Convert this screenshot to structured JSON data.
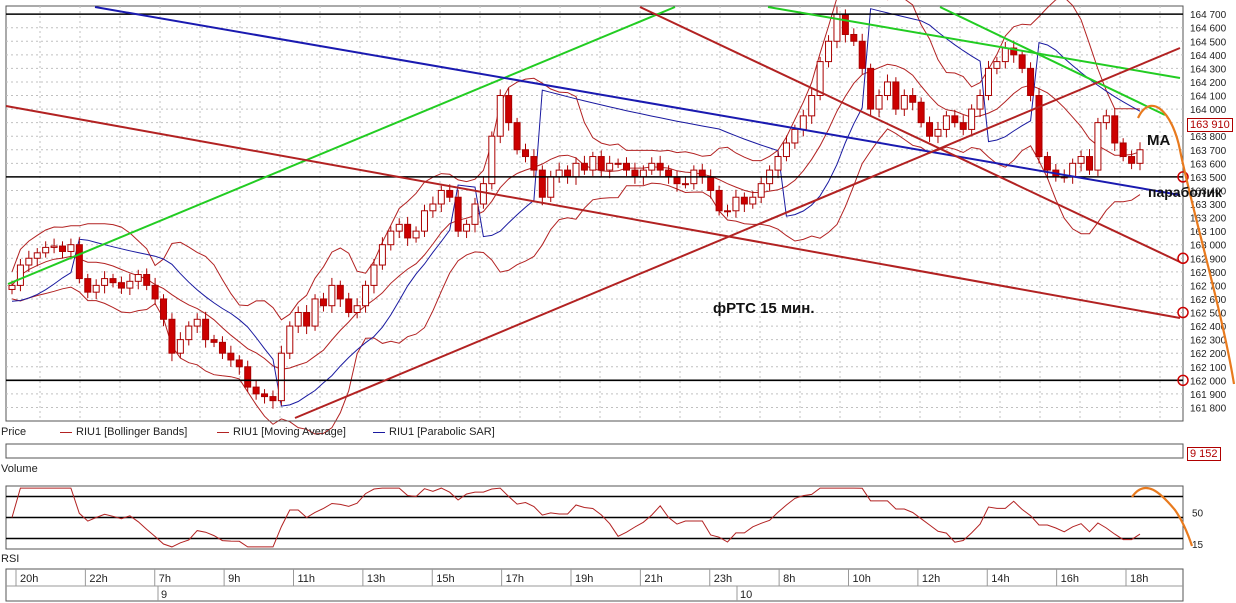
{
  "chart_data": {
    "type": "candlestick",
    "title": "фРТС   15 мин.",
    "price_axis": {
      "range": [
        161700,
        164760
      ],
      "ticks": [
        161800,
        161900,
        162000,
        162100,
        162200,
        162300,
        162400,
        162500,
        162600,
        162700,
        162800,
        162900,
        163000,
        163100,
        163200,
        163300,
        163400,
        163500,
        163600,
        163700,
        163800,
        163900,
        164000,
        164100,
        164200,
        164300,
        164400,
        164500,
        164600,
        164700
      ],
      "tick_labels": [
        "161 800",
        "161 900",
        "162 000",
        "162 100",
        "162 200",
        "162 300",
        "162 400",
        "162 500",
        "162 600",
        "162 700",
        "162 800",
        "162 900",
        "163 000",
        "163 100",
        "163 200",
        "163 300",
        "163 400",
        "163 500",
        "163 600",
        "163 700",
        "163 800",
        "163 900",
        "164 000",
        "164 100",
        "164 200",
        "164 300",
        "164 400",
        "164 500",
        "164 600",
        "164 700"
      ],
      "last_value": "163 910"
    },
    "time_axis": {
      "labels": [
        "20h",
        "22h",
        "7h",
        "9h",
        "11h",
        "13h",
        "15h",
        "17h",
        "19h",
        "21h",
        "23h",
        "8h",
        "10h",
        "12h",
        "14h",
        "16h",
        "18h"
      ],
      "dates": [
        "9",
        "10"
      ]
    },
    "legend": [
      "Price",
      "RIU1 [Bollinger Bands]",
      "RIU1 [Moving Average]",
      "RIU1 [Parabolic SAR]"
    ],
    "closes": [
      162700,
      162850,
      162900,
      162940,
      162980,
      162990,
      162950,
      163000,
      162750,
      162650,
      162700,
      162750,
      162720,
      162680,
      162730,
      162780,
      162700,
      162600,
      162450,
      162200,
      162300,
      162400,
      162450,
      162300,
      162280,
      162200,
      162150,
      162100,
      161950,
      161900,
      161880,
      161850,
      162200,
      162400,
      162500,
      162400,
      162600,
      162550,
      162700,
      162600,
      162500,
      162550,
      162700,
      162850,
      163000,
      163100,
      163150,
      163050,
      163100,
      163250,
      163300,
      163400,
      163350,
      163100,
      163150,
      163300,
      163450,
      163800,
      164100,
      163900,
      163700,
      163650,
      163550,
      163350,
      163500,
      163550,
      163500,
      163600,
      163550,
      163650,
      163550,
      163600,
      163600,
      163550,
      163500,
      163550,
      163600,
      163550,
      163500,
      163450,
      163450,
      163550,
      163500,
      163400,
      163250,
      163250,
      163350,
      163300,
      163350,
      163450,
      163550,
      163650,
      163750,
      163850,
      163950,
      164100,
      164350,
      164500,
      164700,
      164550,
      164500,
      164300,
      164000,
      164100,
      164200,
      164000,
      164100,
      164050,
      163900,
      163800,
      163850,
      163950,
      163900,
      163850,
      164000,
      164100,
      164300,
      164350,
      164450,
      164400,
      164300,
      164100,
      163650,
      163550,
      163500,
      163500,
      163600,
      163650,
      163550,
      163900,
      163950,
      163750,
      163650,
      163600,
      163700
    ],
    "horizontal_levels": [
      164700,
      163500,
      162000
    ],
    "circled_levels": [
      163500,
      162900,
      162500,
      162000
    ],
    "annotations": [
      "MA",
      "параболик"
    ],
    "volume": {
      "label": "Volume",
      "last_value": "9 152"
    },
    "rsi": {
      "label": "RSI",
      "levels": [
        70,
        50,
        30
      ],
      "tick_labels": [
        "50",
        "15"
      ]
    }
  },
  "colors": {
    "up_body": "#ffffff",
    "down_body": "#cc0000",
    "candle_outline": "#aa0000",
    "bollinger": "#b22222",
    "moving_average": "#b22222",
    "sar": "#1a1aa0",
    "trend_green": "#22cc22",
    "trend_blue": "#1a1ab0",
    "trend_red": "#b22222",
    "level_black": "#000000",
    "forecast_orange": "#e87a1e",
    "grid": "#c0c0c0"
  }
}
